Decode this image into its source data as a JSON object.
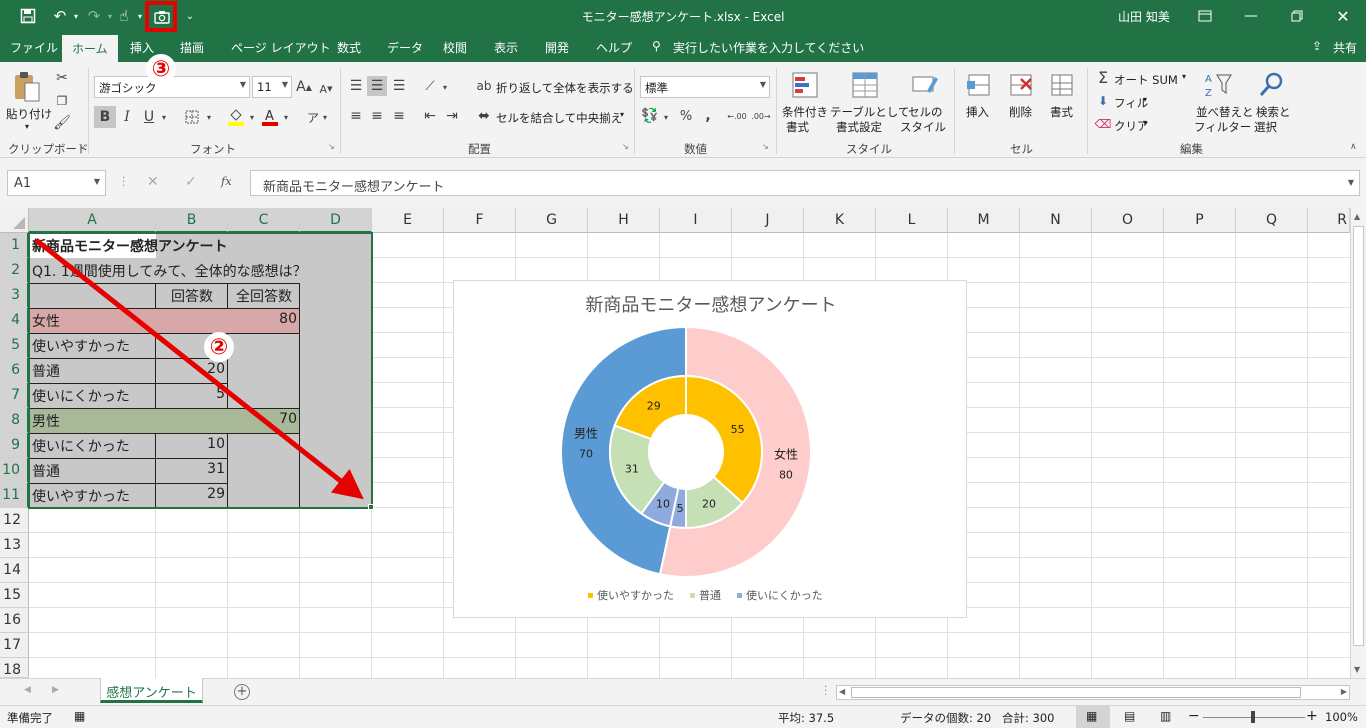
{
  "window": {
    "title": "モニター感想アンケート.xlsx  -  Excel",
    "user": "山田 知美"
  },
  "ribbon_tabs": [
    "ファイル",
    "ホーム",
    "挿入",
    "描画",
    "ページ レイアウト",
    "数式",
    "データ",
    "校閲",
    "表示",
    "開発",
    "ヘルプ"
  ],
  "tell_me": "実行したい作業を入力してください",
  "share": "共有",
  "ribbon": {
    "paste": "貼り付け",
    "clipboard": "クリップボード",
    "font_name": "游ゴシック",
    "font_size": "11",
    "font_group": "フォント",
    "wrap_text": "折り返して全体を表示する",
    "merge_center": "セルを結合して中央揃え",
    "alignment_group": "配置",
    "number_format": "標準",
    "number_group": "数値",
    "conditional_format": [
      "条件付き",
      "書式"
    ],
    "format_as_table": [
      "テーブルとして",
      "書式設定"
    ],
    "cell_styles": [
      "セルの",
      "スタイル"
    ],
    "styles_group": "スタイル",
    "insert": "挿入",
    "delete": "削除",
    "format": "書式",
    "cells_group": "セル",
    "autosum": "オート SUM",
    "fill": "フィル",
    "clear": "クリア",
    "sort_filter": [
      "並べ替えと",
      "フィルター"
    ],
    "find_select": [
      "検索と",
      "選択"
    ],
    "editing_group": "編集",
    "bold": "B",
    "italic": "I",
    "underline": "U",
    "percent": "%"
  },
  "formula_bar": {
    "name_box": "A1",
    "fx": "fx",
    "content": "新商品モニター感想アンケート"
  },
  "columns": [
    "A",
    "B",
    "C",
    "D",
    "E",
    "F",
    "G",
    "H",
    "I",
    "J",
    "K",
    "L",
    "M",
    "N",
    "O",
    "P",
    "Q",
    "R"
  ],
  "rows": [
    "1",
    "2",
    "3",
    "4",
    "5",
    "6",
    "7",
    "8",
    "9",
    "10",
    "11",
    "12",
    "13",
    "14",
    "15",
    "16",
    "17",
    "18"
  ],
  "cells": {
    "A1": "新商品モニター感想アンケート",
    "A2": "Q1. 1週間使用してみて、全体的な感想は？",
    "B3": "回答数",
    "C3": "全回答数",
    "A4": "女性",
    "C4": "80",
    "A5": "使いやすかった",
    "B5": "55",
    "A6": "普通",
    "B6": "20",
    "A7": "使いにくかった",
    "B7": "5",
    "A8": "男性",
    "C8": "70",
    "A9": "使いにくかった",
    "B9": "10",
    "A10": "普通",
    "B10": "31",
    "A11": "使いやすかった",
    "B11": "29"
  },
  "chart_data": {
    "type": "doughnut",
    "title": "新商品モニター感想アンケート",
    "outer": [
      {
        "label": "女性",
        "value": 80,
        "color": "#ffcccc"
      },
      {
        "label": "男性",
        "value": 70,
        "color": "#5b9bd5"
      }
    ],
    "inner": [
      {
        "value": 55,
        "color": "#ffc000",
        "category": "使いやすかった"
      },
      {
        "value": 20,
        "color": "#c5e0b4",
        "category": "普通"
      },
      {
        "value": 5,
        "color": "#8faadc",
        "category": "使いにくかった"
      },
      {
        "value": 10,
        "color": "#8faadc",
        "category": "使いにくかった"
      },
      {
        "value": 31,
        "color": "#c5e0b4",
        "category": "普通"
      },
      {
        "value": 29,
        "color": "#ffc000",
        "category": "使いやすかった"
      }
    ],
    "legend": [
      {
        "name": "使いやすかった",
        "color": "#ffc000"
      },
      {
        "name": "普通",
        "color": "#c5e0b4"
      },
      {
        "name": "使いにくかった",
        "color": "#8faadc"
      }
    ],
    "legend_position": "bottom"
  },
  "annotations": {
    "badge2": "②",
    "badge3": "③"
  },
  "sheet_tab": "感想アンケート",
  "status": {
    "ready": "準備完了",
    "average": "平均: 37.5",
    "count": "データの個数: 20",
    "sum": "合計: 300",
    "zoom": "100%"
  },
  "colors": {
    "excel_green": "#217346",
    "female_fill": "#d8a8a8",
    "male_fill": "#a8b898",
    "selection_fill": "#c8c8c8",
    "arrow_red": "#e60000"
  }
}
